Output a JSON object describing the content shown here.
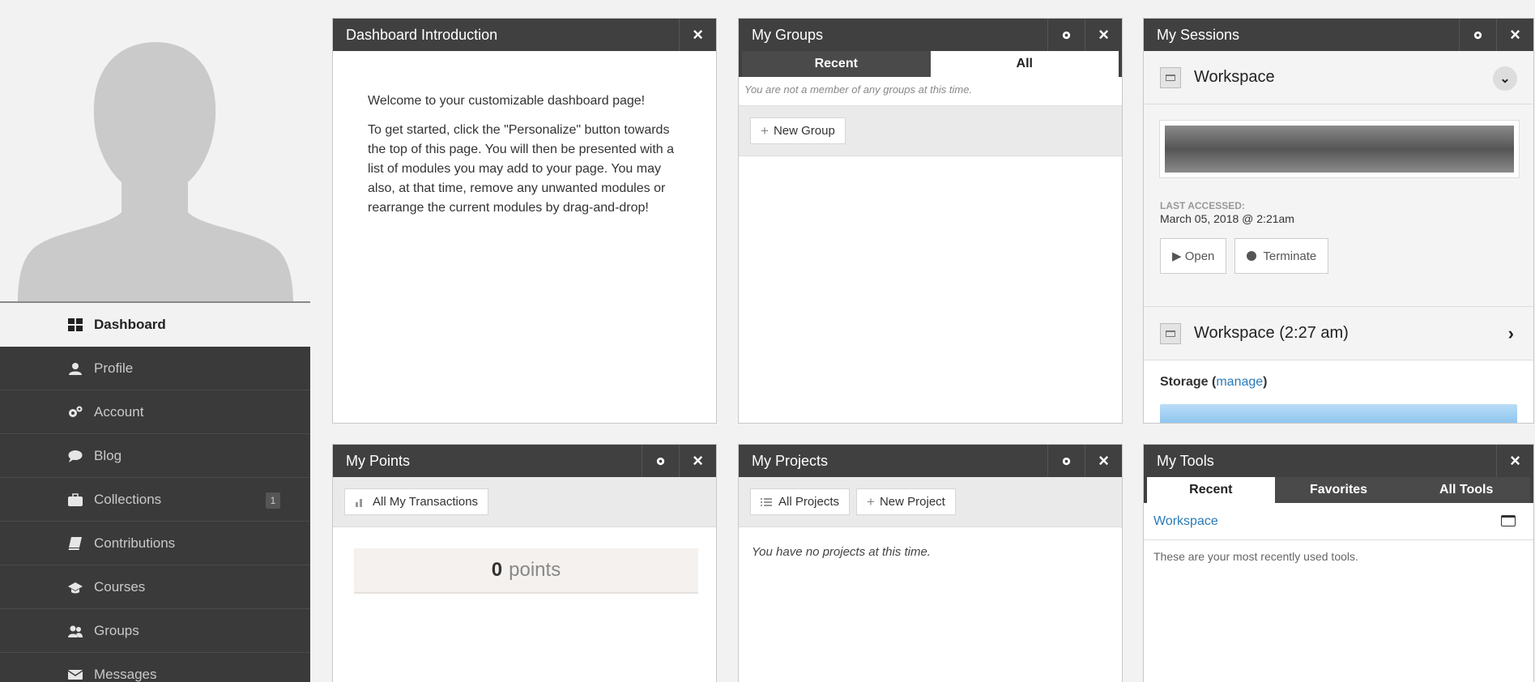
{
  "sidebar": {
    "items": [
      {
        "label": "Dashboard",
        "icon": "dashboard-icon",
        "active": true
      },
      {
        "label": "Profile",
        "icon": "user-icon"
      },
      {
        "label": "Account",
        "icon": "gears-icon"
      },
      {
        "label": "Blog",
        "icon": "comment-icon"
      },
      {
        "label": "Collections",
        "icon": "briefcase-icon",
        "badge": "1"
      },
      {
        "label": "Contributions",
        "icon": "book-icon"
      },
      {
        "label": "Courses",
        "icon": "graduation-cap-icon"
      },
      {
        "label": "Groups",
        "icon": "users-icon"
      },
      {
        "label": "Messages",
        "icon": "envelope-icon"
      }
    ]
  },
  "intro": {
    "title": "Dashboard Introduction",
    "close": "×",
    "p1": "Welcome to your customizable dashboard page!",
    "p2": "To get started, click the \"Personalize\" button towards the top of this page. You will then be presented with a list of modules you may add to your page. You may also, at that time, remove any unwanted modules or rearrange the current modules by drag-and-drop!"
  },
  "groups": {
    "title": "My Groups",
    "close": "×",
    "tab_recent": "Recent",
    "tab_all": "All",
    "empty": "You are not a member of any groups at this time.",
    "new_group": "New Group",
    "plus": "+"
  },
  "sessions": {
    "title": "My Sessions",
    "close": "×",
    "session1": "Workspace",
    "last_accessed_label": "LAST ACCESSED:",
    "last_accessed_value": "March 05, 2018 @ 2:21am",
    "open": "▶ Open",
    "terminate": "Terminate",
    "session2": "Workspace (2:27 am)",
    "storage_label": "Storage (",
    "storage_link": "manage",
    "storage_close": ")"
  },
  "points": {
    "title": "My Points",
    "close": "×",
    "all_transactions": "All My Transactions",
    "count": "0",
    "unit": "points"
  },
  "projects": {
    "title": "My Projects",
    "close": "×",
    "all_projects": "All Projects",
    "new_project": "New Project",
    "plus": "+",
    "empty": "You have no projects at this time."
  },
  "tools": {
    "title": "My Tools",
    "close": "×",
    "tab_recent": "Recent",
    "tab_favorites": "Favorites",
    "tab_all": "All Tools",
    "workspace_link": "Workspace",
    "note": "These are your most recently used tools."
  }
}
